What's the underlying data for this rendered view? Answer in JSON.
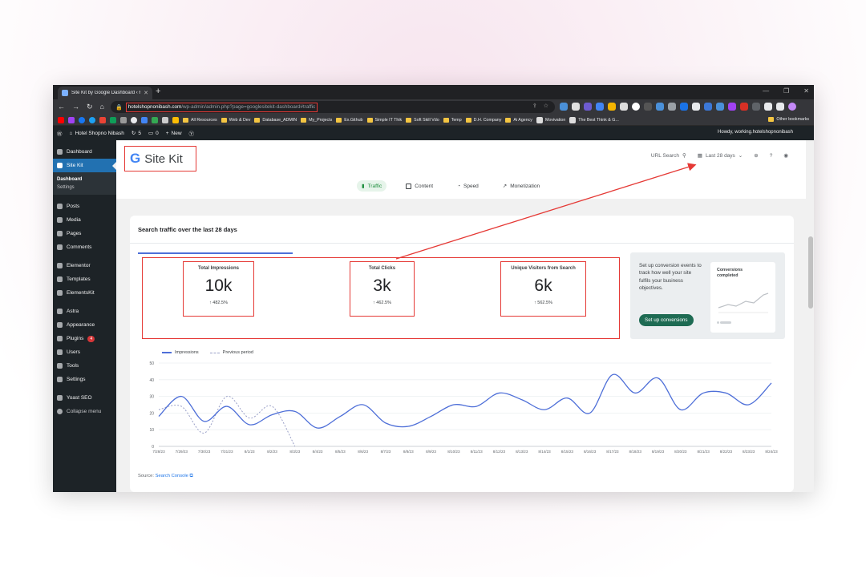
{
  "browser": {
    "tab_title": "Site Kit by Google Dashboard ‹ H...",
    "url_host": "hotelshopnonibash.com",
    "url_path": "/wp-admin/admin.php?page=googlesitekit-dashboard#traffic",
    "bookmarks": [
      "All Resources",
      "Web & Dev",
      "Database_ADMIN",
      "My_Projects",
      "Ex.Github",
      "Simple IT Thik",
      "Soft Skill Vdo",
      "Temp",
      "D.H. Company",
      "Ai Agency",
      "Movivation",
      "The Best Think & G..."
    ],
    "other_bookmarks": "Other bookmarks"
  },
  "adminbar": {
    "site_name": "Hotel Shopno Nibash",
    "updates": "5",
    "comments": "0",
    "new_label": "New",
    "howdy": "Howdy, working.hotelshopnonibash"
  },
  "sidebar": {
    "items": [
      {
        "label": "Dashboard"
      },
      {
        "label": "Site Kit"
      },
      {
        "label": "Posts"
      },
      {
        "label": "Media"
      },
      {
        "label": "Pages"
      },
      {
        "label": "Comments"
      },
      {
        "label": "Elementor"
      },
      {
        "label": "Templates"
      },
      {
        "label": "ElementsKit"
      },
      {
        "label": "Astra"
      },
      {
        "label": "Appearance"
      },
      {
        "label": "Plugins",
        "badge": "4"
      },
      {
        "label": "Users"
      },
      {
        "label": "Tools"
      },
      {
        "label": "Settings"
      },
      {
        "label": "Yoast SEO"
      },
      {
        "label": "Collapse menu"
      }
    ],
    "sub": [
      "Dashboard",
      "Settings"
    ]
  },
  "sitekit": {
    "g_letter": "G",
    "title": "Site Kit",
    "url_search": "URL Search",
    "date_range": "Last 28 days",
    "tabs": [
      "Traffic",
      "Content",
      "Speed",
      "Monetization"
    ]
  },
  "card": {
    "title": "Search traffic over the last 28 days",
    "metrics": [
      {
        "label": "Total Impressions",
        "value": "10k",
        "change": "↑ 482.5%"
      },
      {
        "label": "Total Clicks",
        "value": "3k",
        "change": "↑ 462.5%"
      },
      {
        "label": "Unique Visitors from Search",
        "value": "6k",
        "change": "↑ 562.5%"
      }
    ],
    "conversion": {
      "text": "Set up conversion events to track how well your site fulfils your business objectives.",
      "button": "Set up conversions",
      "preview_title": "Conversions completed"
    },
    "source_label": "Source:",
    "source_link": "Search Console"
  },
  "colors": {
    "wp_dark": "#1d2327",
    "wp_blue": "#2271b1",
    "annotation_red": "#e53935",
    "series_blue": "#4e6fd8",
    "button_green": "#1e6b53"
  },
  "chart_data": {
    "type": "line",
    "x": [
      "7/28/23",
      "7/29/23",
      "7/30/23",
      "7/31/23",
      "8/1/23",
      "8/2/23",
      "8/3/23",
      "8/4/23",
      "8/5/23",
      "8/6/23",
      "8/7/23",
      "8/8/23",
      "8/9/23",
      "8/10/23",
      "8/11/23",
      "8/12/23",
      "8/13/23",
      "8/14/23",
      "8/15/23",
      "8/16/23",
      "8/17/23",
      "8/18/23",
      "8/19/23",
      "8/20/23",
      "8/21/23",
      "8/22/23",
      "8/23/23",
      "8/24/23"
    ],
    "series": [
      {
        "name": "Impressions",
        "values": [
          18,
          30,
          15,
          24,
          13,
          19,
          21,
          11,
          18,
          25,
          14,
          12,
          18,
          25,
          24,
          32,
          28,
          22,
          29,
          20,
          43,
          32,
          41,
          22,
          32,
          32,
          25,
          38
        ]
      },
      {
        "name": "Previous period",
        "values": [
          22,
          24,
          8,
          30,
          17,
          24,
          0
        ]
      }
    ],
    "ylim": [
      0,
      50
    ],
    "yticks": [
      0,
      10,
      20,
      30,
      40,
      50
    ],
    "legend": "top-left",
    "grid": true
  }
}
